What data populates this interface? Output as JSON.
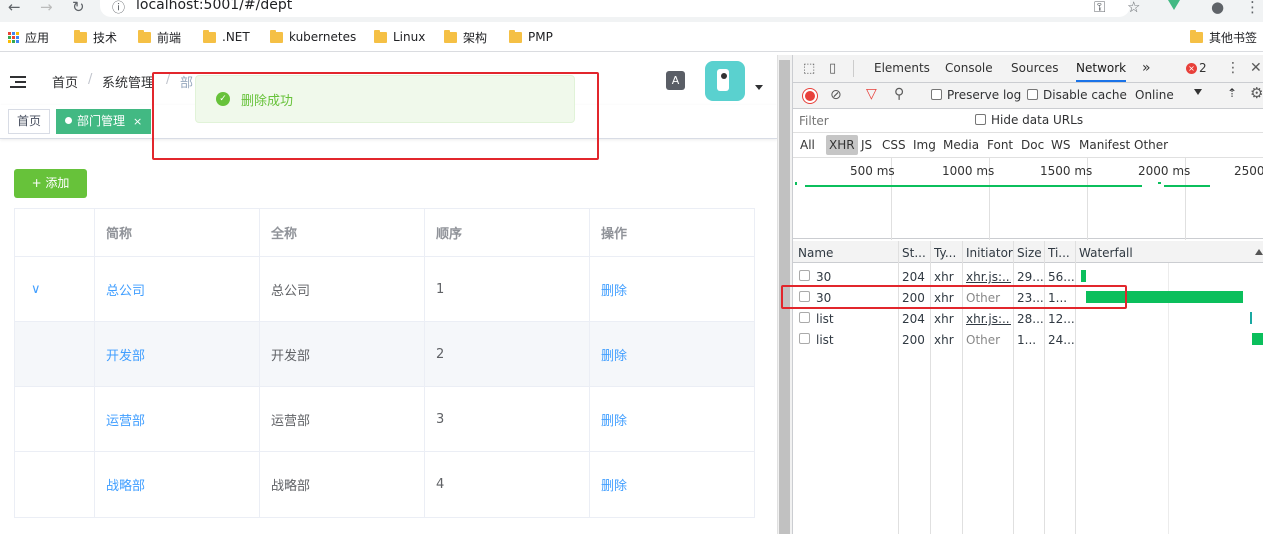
{
  "browser": {
    "url": "localhost:5001/#/dept",
    "bookmarks": [
      "应用",
      "技术",
      "前端",
      ".NET",
      "kubernetes",
      "Linux",
      "架构",
      "PMP"
    ],
    "other_bookmarks": "其他书签"
  },
  "app": {
    "breadcrumb": [
      "首页",
      "系统管理",
      "部"
    ],
    "tags": {
      "home": "首页",
      "active": "部门管理",
      "close": "×"
    },
    "toast": "删除成功",
    "add_button": "+ 添加",
    "table": {
      "headers": [
        "",
        "简称",
        "全称",
        "顺序",
        "操作"
      ],
      "rows": [
        {
          "expand": "∨",
          "short": "总公司",
          "full": "总公司",
          "order": "1",
          "action": "删除"
        },
        {
          "expand": "",
          "short": "开发部",
          "full": "开发部",
          "order": "2",
          "action": "删除"
        },
        {
          "expand": "",
          "short": "运营部",
          "full": "运营部",
          "order": "3",
          "action": "删除"
        },
        {
          "expand": "",
          "short": "战略部",
          "full": "战略部",
          "order": "4",
          "action": "删除"
        }
      ]
    }
  },
  "devtools": {
    "tabs": [
      "Elements",
      "Console",
      "Sources",
      "Network",
      "»"
    ],
    "error_count": "2",
    "toolbar": {
      "preserve_log": "Preserve log",
      "disable_cache": "Disable cache",
      "throttle": "Online"
    },
    "filter": {
      "placeholder": "Filter",
      "hide_data_urls": "Hide data URLs"
    },
    "types": [
      "All",
      "XHR",
      "JS",
      "CSS",
      "Img",
      "Media",
      "Font",
      "Doc",
      "WS",
      "Manifest",
      "Other"
    ],
    "timeline_ticks": [
      "500 ms",
      "1000 ms",
      "1500 ms",
      "2000 ms",
      "2500"
    ],
    "columns": [
      "Name",
      "St...",
      "Ty...",
      "Initiator",
      "Size",
      "Ti...",
      "Waterfall"
    ],
    "requests": [
      {
        "name": "30",
        "status": "204",
        "type": "xhr",
        "initiator": "xhr.js:...",
        "size": "29...",
        "time": "56..."
      },
      {
        "name": "30",
        "status": "200",
        "type": "xhr",
        "initiator": "Other",
        "size": "23...",
        "time": "1..."
      },
      {
        "name": "list",
        "status": "204",
        "type": "xhr",
        "initiator": "xhr.js:...",
        "size": "28...",
        "time": "12..."
      },
      {
        "name": "list",
        "status": "200",
        "type": "xhr",
        "initiator": "Other",
        "size": "1...",
        "time": "24..."
      }
    ]
  },
  "colors": {
    "success": "#67c23a",
    "link": "#409eff",
    "tag_active": "#42b983",
    "highlight": "#e2262c",
    "waterfall": "#0bbf5c"
  }
}
